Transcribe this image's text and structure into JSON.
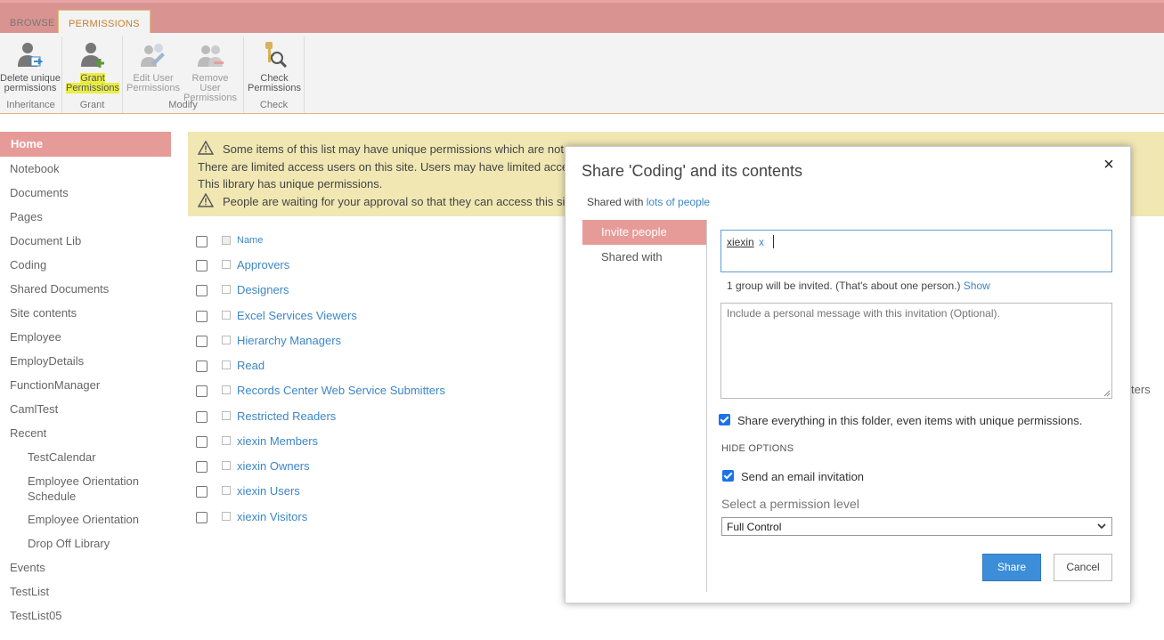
{
  "ribbon": {
    "tabs": [
      "BROWSE",
      "PERMISSIONS"
    ],
    "buttons": {
      "delete_unique": "Delete unique permissions",
      "grant": "Grant Permissions",
      "edit_user": "Edit User Permissions",
      "remove_user": "Remove User Permissions",
      "check": "Check Permissions"
    },
    "groups": [
      "Inheritance",
      "Grant",
      "Modify",
      "Check"
    ]
  },
  "nav": {
    "items": [
      "Home",
      "Notebook",
      "Documents",
      "Pages",
      "Document Lib",
      "Coding",
      "Shared Documents",
      "Site contents",
      "Employee",
      "EmployDetails",
      "FunctionManager",
      "CamlTest",
      "Recent",
      "TestCalendar",
      "Employee Orientation Schedule",
      "Employee Orientation",
      "Drop Off Library",
      "Events",
      "TestList",
      "TestList05"
    ]
  },
  "warning": {
    "line1": "Some items of this list may have unique permissions which are not",
    "line2": "There are limited access users on this site. Users may have limited access",
    "line3": "This library has unique permissions.",
    "line4": "People are waiting for your approval so that they can access this si"
  },
  "list": {
    "header": "Name",
    "rows": [
      "Approvers",
      "Designers",
      "Excel Services Viewers",
      "Hierarchy Managers",
      "Read",
      "Records Center Web Service Submitters",
      "Restricted Readers",
      "xiexin Members",
      "xiexin Owners",
      "xiexin Users",
      "xiexin Visitors"
    ],
    "side_text": "ters"
  },
  "dialog": {
    "title": "Share 'Coding' and its contents",
    "close": "×",
    "shared_prefix": "Shared with ",
    "shared_link": "lots of people",
    "tabs": [
      "Invite people",
      "Shared with"
    ],
    "chip": "xiexin",
    "chip_remove": "x",
    "hint": "1 group will be invited. (That's about one person.) ",
    "hint_link": "Show",
    "message_placeholder": "Include a personal message with this invitation (Optional).",
    "share_everything": "Share everything in this folder, even items with unique permissions.",
    "hide_options": "HIDE OPTIONS",
    "send_email": "Send an email invitation",
    "permission_label": "Select a permission level",
    "permission_value": "Full Control",
    "share_button": "Share",
    "cancel_button": "Cancel"
  }
}
